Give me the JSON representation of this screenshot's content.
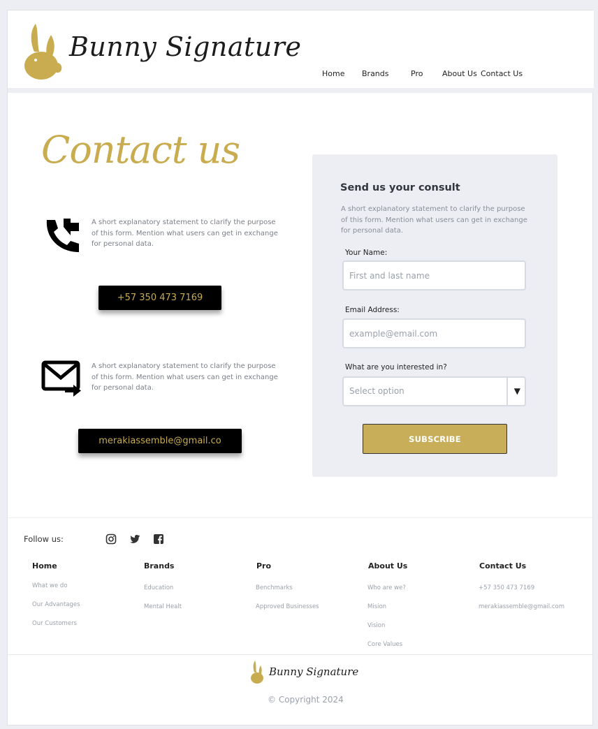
{
  "brand": {
    "name": "Bunny Signature",
    "accent": "#c8ac4f"
  },
  "nav": {
    "items": [
      "Home",
      "Brands",
      "Pro",
      "About Us",
      "Contact Us"
    ]
  },
  "contact": {
    "title": "Contact us",
    "phone_description": "A short explanatory statement to clarify the purpose of this form. Mention what users can get in exchange for personal data.",
    "phone_button": "+57 350 473 7169",
    "email_description": "A short explanatory statement to clarify the purpose of this form. Mention what users can get in exchange for personal data.",
    "email_button": "merakiassemble@gmail.co",
    "phone_icon": "phone-forward-icon",
    "email_icon": "email-forward-icon"
  },
  "form": {
    "title": "Send us your consult",
    "description": "A short explanatory statement to clarify the purpose of this form. Mention what users can get in exchange for personal data.",
    "name_label": "Your Name:",
    "name_placeholder": "First and last name",
    "email_label": "Email Address:",
    "email_placeholder": "example@email.com",
    "interest_label": "What are you interested in?",
    "interest_placeholder": "Select option",
    "submit_label": "SUBSCRIBE"
  },
  "footer": {
    "follow_label": "Follow us:",
    "social_icons": [
      "instagram-icon",
      "twitter-icon",
      "facebook-icon"
    ],
    "columns": [
      {
        "heading": "Home",
        "links": [
          "What we do",
          "Our Advantages",
          "Our Customers"
        ]
      },
      {
        "heading": "Brands",
        "links": [
          "Education",
          "Mental Healt"
        ]
      },
      {
        "heading": "Pro",
        "links": [
          "Benchmarks",
          "Approved Businesses"
        ]
      },
      {
        "heading": "About Us",
        "links": [
          "Who are we?",
          "Mision",
          "Vision",
          "Core Values"
        ]
      },
      {
        "heading": "Contact Us",
        "links": [
          "+57 350 473 7169",
          "merakiassemble@gmail.com"
        ]
      }
    ],
    "logo_text": "Bunny Signature",
    "copyright": "© Copyright 2024"
  }
}
